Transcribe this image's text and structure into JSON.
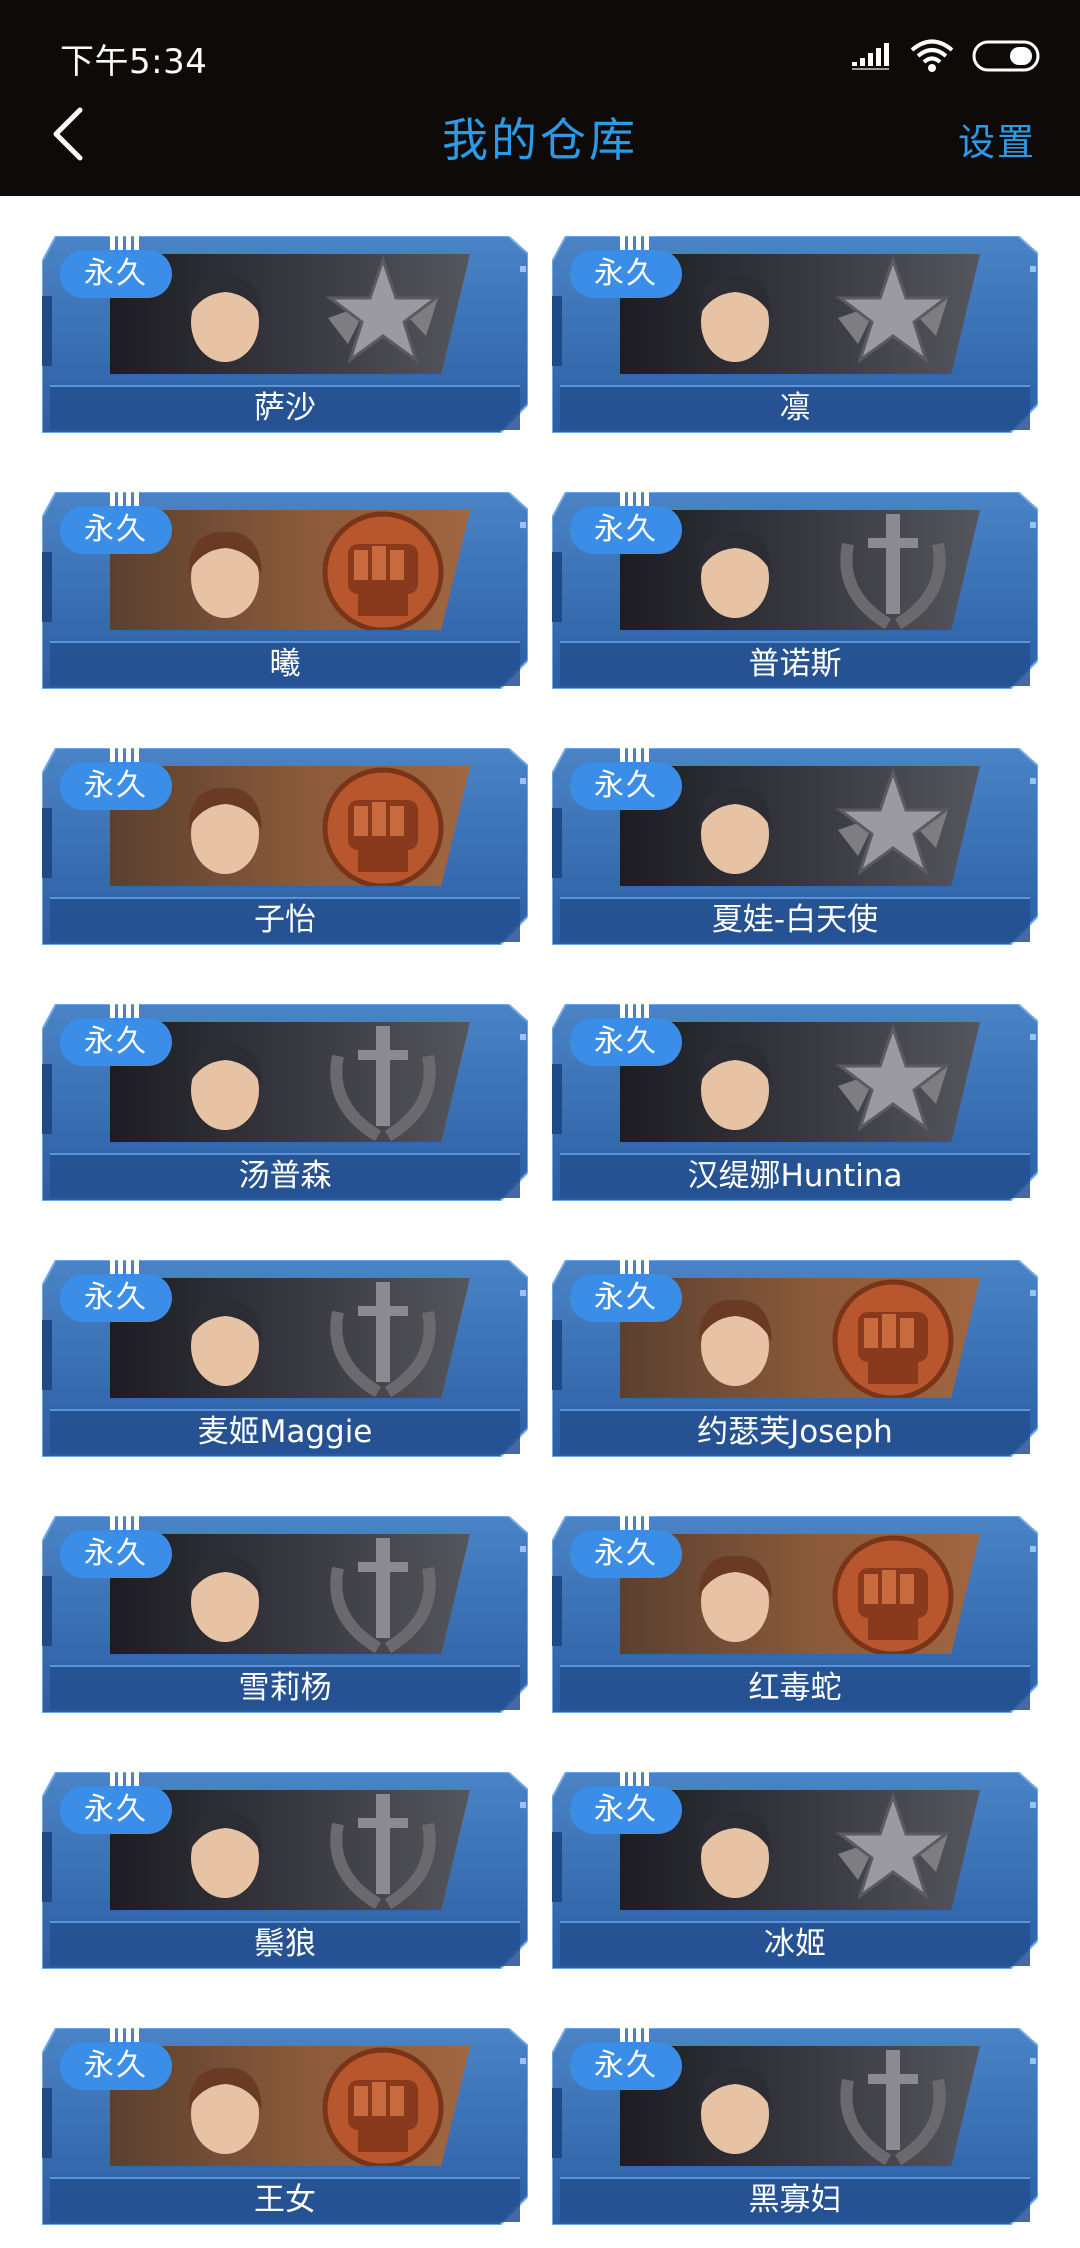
{
  "status_bar": {
    "time": "下午5:34"
  },
  "nav": {
    "title": "我的仓库",
    "settings_label": "设置",
    "accent_color": "#2b9be8"
  },
  "colors": {
    "card_blue": "#2f5d9e",
    "badge_blue": "#3a8ee8",
    "header_bg": "#0e0a08"
  },
  "items": [
    {
      "badge": "永久",
      "name": "萨沙",
      "emblem": "star-wings-emblem",
      "tone": "dark"
    },
    {
      "badge": "永久",
      "name": "凛",
      "emblem": "star-wings-emblem",
      "tone": "dark"
    },
    {
      "badge": "永久",
      "name": "曦",
      "emblem": "fist-emblem",
      "tone": "bronze"
    },
    {
      "badge": "永久",
      "name": "普诺斯",
      "emblem": "sword-wreath-emblem",
      "tone": "dark"
    },
    {
      "badge": "永久",
      "name": "子怡",
      "emblem": "fist-emblem",
      "tone": "bronze"
    },
    {
      "badge": "永久",
      "name": "夏娃-白天使",
      "emblem": "star-wings-emblem",
      "tone": "dark"
    },
    {
      "badge": "永久",
      "name": "汤普森",
      "emblem": "sword-wreath-emblem",
      "tone": "dark"
    },
    {
      "badge": "永久",
      "name": "汉缇娜Huntina",
      "emblem": "star-wings-emblem",
      "tone": "dark"
    },
    {
      "badge": "永久",
      "name": "麦姬Maggie",
      "emblem": "sword-wreath-emblem",
      "tone": "dark"
    },
    {
      "badge": "永久",
      "name": "约瑟芙Joseph",
      "emblem": "fist-emblem",
      "tone": "bronze"
    },
    {
      "badge": "永久",
      "name": "雪莉杨",
      "emblem": "sword-wreath-emblem",
      "tone": "dark"
    },
    {
      "badge": "永久",
      "name": "红毒蛇",
      "emblem": "fist-emblem",
      "tone": "bronze"
    },
    {
      "badge": "永久",
      "name": "鬃狼",
      "emblem": "sword-wreath-emblem",
      "tone": "dark"
    },
    {
      "badge": "永久",
      "name": "冰姬",
      "emblem": "star-wings-emblem",
      "tone": "dark"
    },
    {
      "badge": "永久",
      "name": "王女",
      "emblem": "fist-emblem",
      "tone": "bronze"
    },
    {
      "badge": "永久",
      "name": "黑寡妇",
      "emblem": "sword-wreath-emblem",
      "tone": "dark"
    }
  ]
}
